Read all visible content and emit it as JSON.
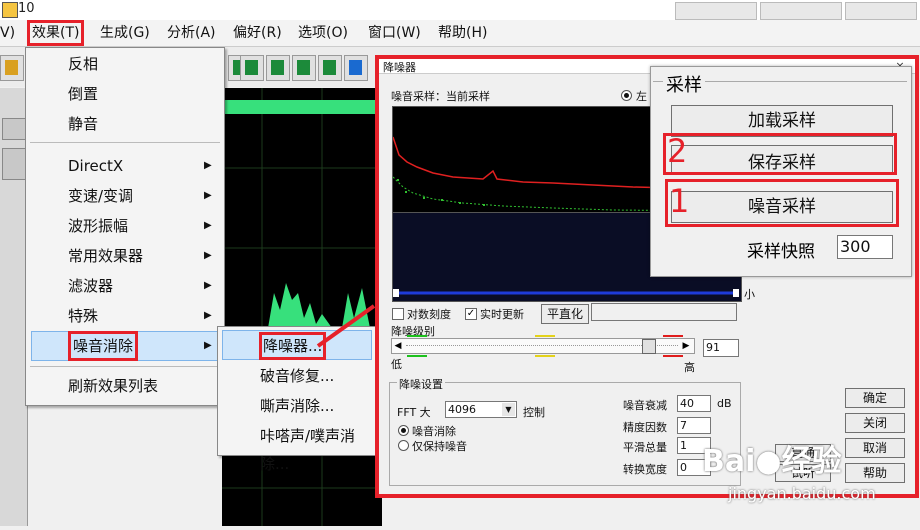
{
  "titlebar": {
    "word": "10"
  },
  "menubar": {
    "items": [
      {
        "label": "V)"
      },
      {
        "label": "效果(T)"
      },
      {
        "label": "生成(G)"
      },
      {
        "label": "分析(A)"
      },
      {
        "label": "偏好(R)"
      },
      {
        "label": "选项(O)"
      },
      {
        "label": "窗口(W)"
      },
      {
        "label": "帮助(H)"
      }
    ]
  },
  "effects_menu": {
    "items": [
      {
        "label": "反相"
      },
      {
        "label": "倒置"
      },
      {
        "label": "静音"
      },
      {
        "label": "DirectX",
        "arrow": "▶"
      },
      {
        "label": "变速/变调",
        "arrow": "▶"
      },
      {
        "label": "波形振幅",
        "arrow": "▶"
      },
      {
        "label": "常用效果器",
        "arrow": "▶"
      },
      {
        "label": "滤波器",
        "arrow": "▶"
      },
      {
        "label": "特殊",
        "arrow": "▶"
      },
      {
        "label": "噪音消除",
        "arrow": "▶"
      },
      {
        "label": "刷新效果列表"
      }
    ]
  },
  "noise_submenu": {
    "items": [
      {
        "label": "降噪器..."
      },
      {
        "label": "破音修复..."
      },
      {
        "label": "嘶声消除..."
      },
      {
        "label": "咔嗒声/噗声消除..."
      }
    ]
  },
  "dialog": {
    "title": "降噪器",
    "close": "×",
    "noise_sample_label": "噪音采样：当前采样",
    "channel_left": "左",
    "small_label": "小",
    "log_scale_label": "对数刻度",
    "realtime_label": "实时更新",
    "flatten_button": "平直化",
    "level_label": "降噪级别",
    "low_label": "低",
    "high_label": "高",
    "level_value": "91",
    "level_fraction": 0.92,
    "settings_group": "降噪设置",
    "fft_label": "FFT 大",
    "fft_value": "4096",
    "control_label": "控制",
    "remove_noise_label": "噪音消除",
    "keep_noise_label": "仅保持噪音",
    "reduce_label": "噪音衰减",
    "reduce_value": "40",
    "reduce_unit": "dB",
    "precision_label": "精度因数",
    "precision_value": "7",
    "smooth_label": "平滑总量",
    "smooth_value": "1",
    "transition_label": "转换宽度",
    "transition_value": "0",
    "ok_button": "确定",
    "close_button": "关闭",
    "cancel_button": "取消",
    "help_button": "帮助",
    "preview_button": "试听",
    "bypass_button": "直通"
  },
  "sample_panel": {
    "group_title": "采样",
    "load_button": "加载采样",
    "save_button": "保存采样",
    "noise_button": "噪音采样",
    "snapshot_label": "采样快照",
    "snapshot_value": "300",
    "step1": "1",
    "step2": "2"
  },
  "watermark": {
    "brand": "Bai",
    "brand2": "经验",
    "url": "jingyan.baidu.com"
  },
  "colors": {
    "highlight": "#e6212a",
    "selection": "#cfe6fb",
    "wave": "#37e07c"
  }
}
